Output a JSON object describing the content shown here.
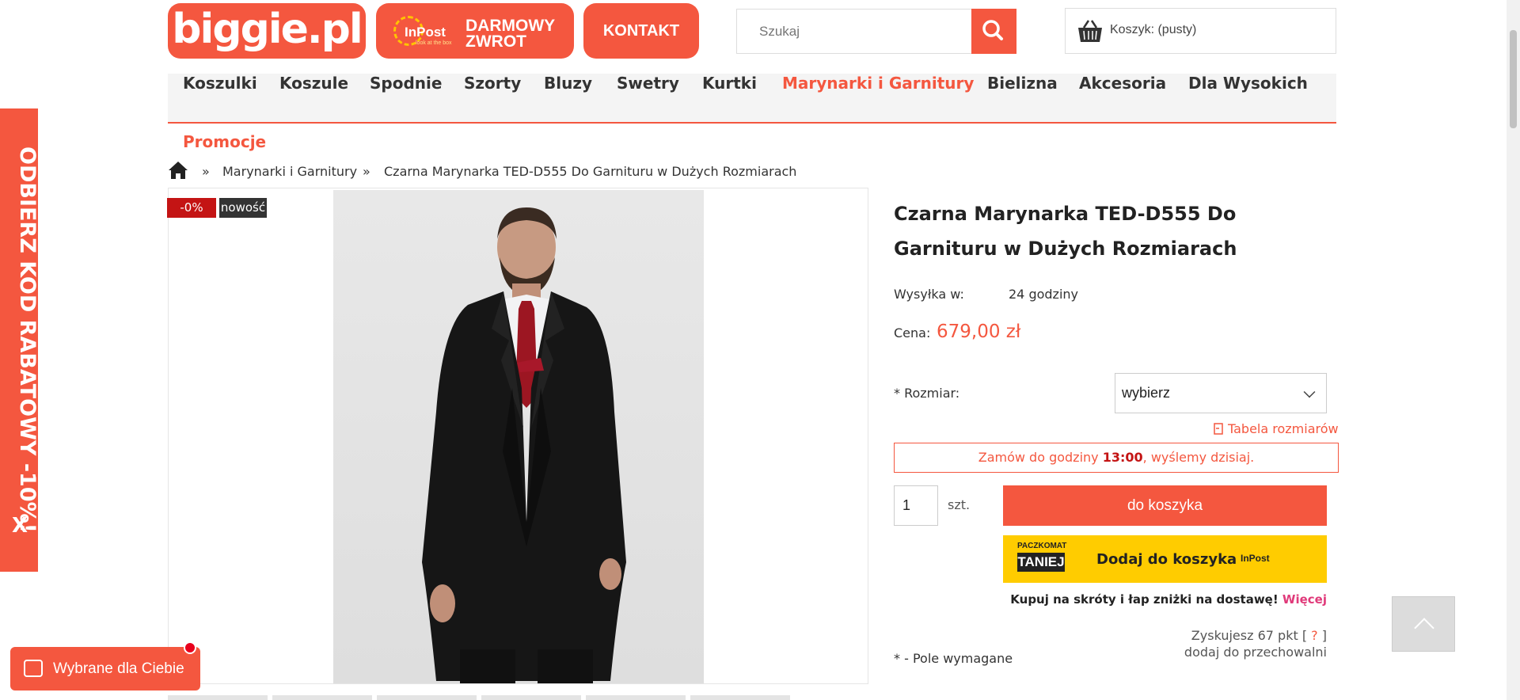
{
  "header": {
    "logo": "biggie.pl",
    "inpost_brand": "InPost",
    "inpost_tagline": "look at the box",
    "inpost_promo": "DARMOWY ZWROT",
    "contact": "KONTAKT",
    "search_placeholder": "Szukaj",
    "cart_label": "Koszyk: (pusty)"
  },
  "nav": {
    "items": [
      {
        "label": "Koszulki"
      },
      {
        "label": "Koszule"
      },
      {
        "label": "Spodnie"
      },
      {
        "label": "Szorty"
      },
      {
        "label": "Bluzy"
      },
      {
        "label": "Swetry"
      },
      {
        "label": "Kurtki"
      },
      {
        "label": "Marynarki i Garnitury",
        "active": true
      },
      {
        "label": "Bielizna"
      },
      {
        "label": "Akcesoria"
      },
      {
        "label": "Dla Wysokich"
      }
    ],
    "promo": "Promocje"
  },
  "breadcrumb": {
    "sep1": "»",
    "category": "Marynarki i Garnitury",
    "sep2": "»",
    "current": "Czarna Marynarka TED-D555 Do Garnituru w Dużych Rozmiarach"
  },
  "gallery": {
    "badge_sale": "-0%",
    "badge_new": "nowość"
  },
  "product": {
    "title": "Czarna Marynarka TED-D555 Do Garnituru w Dużych Rozmiarach",
    "shipping_label": "Wysyłka w:",
    "shipping_value": "24 godziny",
    "price_label": "Cena:",
    "price": "679,00 zł",
    "size_label": "* Rozmiar:",
    "size_value": "wybierz",
    "size_table": "Tabela rozmiarów",
    "deadline_before": "Zamów do godziny ",
    "deadline_time": "13:00",
    "deadline_after": ", wyślemy dzisiaj.",
    "quantity": "1",
    "quantity_unit": "szt.",
    "add_to_cart": "do koszyka",
    "paczkomat_top": "PACZKOMAT",
    "paczkomat_bottom": "TANIEJ",
    "paczkomat_add": "Dodaj do koszyka",
    "paczkomat_brand": "InPost",
    "shortcut_text": "Kupuj na skróty i łap zniżki na dostawę! ",
    "shortcut_link": "Więcej",
    "points_text": "Zyskujesz 67 pkt [",
    "points_q": "?",
    "points_close": "]",
    "wishlist": "dodaj do przechowalni",
    "required_note": "* - Pole wymagane"
  },
  "side_banner": {
    "text": "ODBIERZ KOD RABATOWY -10%!",
    "close": "X"
  },
  "picked_for_you": "Wybrane dla Ciebie",
  "colors": {
    "accent": "#f4573f",
    "sale_badge": "#c41414",
    "inpost_yellow": "#ffcc00"
  }
}
